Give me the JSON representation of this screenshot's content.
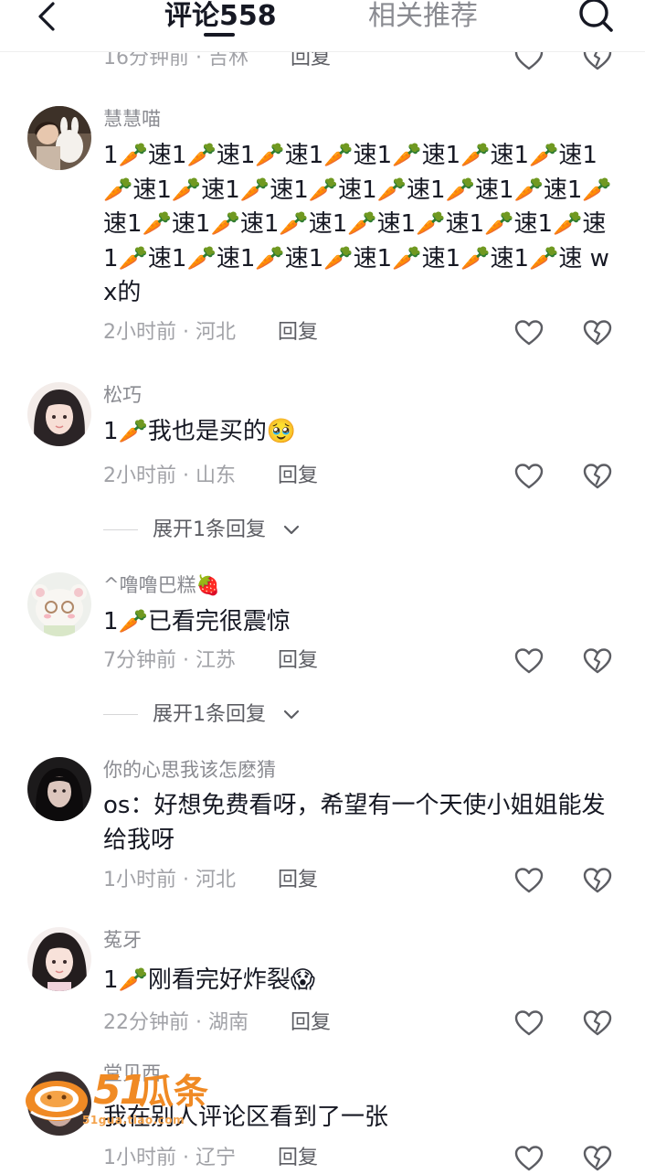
{
  "header": {
    "tab_comments": "评论558",
    "tab_related": "相关推荐"
  },
  "top_partial": {
    "time": "16分钟前 · 吉林",
    "reply": "回复"
  },
  "comments": [
    {
      "username": "慧慧喵",
      "text": "1🥕速1🥕速1🥕速1🥕速1🥕速1🥕速1🥕速1🥕速1🥕速1🥕速1🥕速1🥕速1🥕速1🥕速1🥕速1🥕速1🥕速1🥕速1🥕速1🥕速1🥕速1🥕速1🥕速1🥕速1🥕速1🥕速1🥕速1🥕速1🥕速 wx的",
      "meta": "2小时前 · 河北",
      "reply": "回复"
    },
    {
      "username": "松巧",
      "text": "1🥕我也是买的🥹",
      "meta": "2小时前 · 山东",
      "reply": "回复",
      "expand": "展开1条回复"
    },
    {
      "username": "^噜噜巴糕🍓",
      "text": "1🥕已看完很震惊",
      "meta": "7分钟前 · 江苏",
      "reply": "回复",
      "expand": "展开1条回复"
    },
    {
      "username": "你的心思我该怎麽猜",
      "text": "os：好想免费看呀，希望有一个天使小姐姐能发给我呀",
      "meta": "1小时前 · 河北",
      "reply": "回复"
    },
    {
      "username": "菟牙",
      "text": "1🥕刚看完好炸裂😱",
      "meta": "22分钟前 · 湖南",
      "reply": "回复"
    },
    {
      "username": "堂贝西",
      "text": "我在别人评论区看到了一张",
      "meta": "1小时前 · 辽宁",
      "reply": "回复"
    }
  ],
  "watermark": {
    "number": "51",
    "text": "瓜条",
    "url": "51gua.tiao.com"
  },
  "colors": {
    "text": "#161823",
    "meta": "#a1a2a7",
    "reply": "#5c5d63",
    "watermark": "#f08a24"
  },
  "icons": [
    "back-arrow-icon",
    "search-icon",
    "heart-icon",
    "broken-heart-icon",
    "chevron-down-icon"
  ]
}
